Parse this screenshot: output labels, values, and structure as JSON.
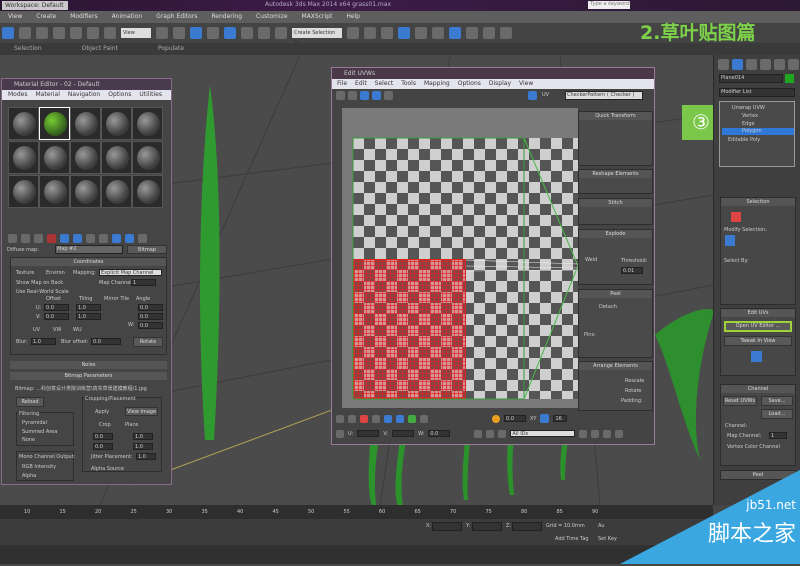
{
  "titlebar": {
    "workspace": "Workspace: Default",
    "app_title": "Autodesk 3ds Max 2014 x64    grass01.max",
    "search_placeholder": "Type a keyword"
  },
  "menu": [
    "View",
    "Create",
    "Modifiers",
    "Animation",
    "Graph Editors",
    "Rendering",
    "Customize",
    "MAXScript",
    "Help"
  ],
  "toolbar": {
    "view_select": "View",
    "selection_set": "Create Selection Se"
  },
  "ribbon": [
    "Selection",
    "Object Paint",
    "Populate"
  ],
  "overlay_heading": "2.草叶贴图篇",
  "step_badge": "③",
  "material_editor": {
    "title": "Material Editor - 02 - Default",
    "menu": [
      "Modes",
      "Material",
      "Navigation",
      "Options",
      "Utilities"
    ],
    "diffuse_label": "Diffuse map:",
    "map_name": "Map #2",
    "map_type": "Bitmap",
    "coordinates": {
      "header": "Coordinates",
      "texture": "Texture",
      "environ": "Environ",
      "mapping_label": "Mapping:",
      "mapping": "Explicit Map Channel",
      "show_map_on_back": "Show Map on Back",
      "map_channel_label": "Map Channel:",
      "map_channel": "1",
      "real_world": "Use Real-World Scale",
      "offset": "Offset",
      "tiling": "Tiling",
      "mirror_tile": "Mirror Tile",
      "angle": "Angle",
      "u": "U:",
      "v": "V:",
      "w": "W:",
      "offset_u": "0.0",
      "offset_v": "0.0",
      "tiling_u": "1.0",
      "tiling_v": "1.0",
      "angle_u": "0.0",
      "angle_v": "0.0",
      "angle_w": "0.0",
      "uv": "UV",
      "vw": "VW",
      "wu": "WU",
      "blur_label": "Blur:",
      "blur": "1.0",
      "blur_offset_label": "Blur offset:",
      "blur_offset": "0.0",
      "rotate": "Rotate"
    },
    "noise": "Noise",
    "bitmap_params": {
      "header": "Bitmap Parameters",
      "bitmap_label": "Bitmap:",
      "bitmap_path": "...科创意设计类院训练营\\真实草景建模教程\\1.jpg",
      "reload": "Reload",
      "cropping": "Cropping/Placement",
      "apply": "Apply",
      "view_image": "View Image",
      "crop": "Crop",
      "place": "Place",
      "u": "0.0",
      "v": "0.0",
      "w": "1.0",
      "h": "1.0",
      "jitter": "Jitter Placement:",
      "jitter_val": "1.0",
      "filtering": "Filtering",
      "pyramidal": "Pyramidal",
      "summed": "Summed Area",
      "none": "None",
      "mono": "Mono Channel Output:",
      "rgb_intensity": "RGB Intensity",
      "alpha": "Alpha",
      "alpha_source": "Alpha Source"
    }
  },
  "edit_uvws": {
    "title": "Edit UVWs",
    "menu": [
      "File",
      "Edit",
      "Select",
      "Tools",
      "Mapping",
      "Options",
      "Display",
      "View"
    ],
    "uv_label": "UV",
    "texture_select": "CheckerPattern  ( Checker )",
    "panels": {
      "quick_transform": "Quick Transform",
      "reshape": "Reshape Elements",
      "stitch": "Stitch",
      "explode": "Explode",
      "weld": "Weld",
      "threshold_label": "Threshold:",
      "threshold": "0.01",
      "peel": "Peel",
      "detach": "Detach",
      "pins": "Pins:",
      "arrange": "Arrange Elements",
      "rescale": "Rescale",
      "rotate": "Rotate",
      "padding": "Padding:"
    },
    "bottom": {
      "soft_val": "0.0",
      "u_label": "U:",
      "v_label": "V:",
      "w_label": "W:",
      "w_val": "0.0",
      "xy": "XY",
      "grid_val": "16",
      "ids": "All IDs"
    }
  },
  "command_panel": {
    "object_name": "Plane014",
    "object_color": "#1fa51f",
    "modifier_list": "Modifier List",
    "stack": [
      {
        "label": "Unwrap UVW"
      },
      {
        "label": "Vertex"
      },
      {
        "label": "Edge"
      },
      {
        "label": "Polygon",
        "selected": true
      },
      {
        "label": "Editable Poly"
      }
    ],
    "selection": "Selection",
    "modify_selection": "Modify Selection:",
    "select_by": "Select By:",
    "edit_uvs": "Edit UVs",
    "open_uv_editor": "Open UV Editor ...",
    "tweak_in_view": "Tweak In View",
    "channel": "Channel",
    "reset_uvws": "Reset UVWs",
    "save": "Save...",
    "load": "Load...",
    "channel_group": "Channel:",
    "map_channel": "Map Channel:",
    "map_channel_val": "1",
    "vertex_color_channel": "Vertex Color Channel",
    "peel": "Peel"
  },
  "timeline": {
    "ticks": [
      "10",
      "15",
      "20",
      "25",
      "30",
      "35",
      "40",
      "45",
      "50",
      "55",
      "60",
      "65",
      "70",
      "75",
      "80",
      "85",
      "90"
    ]
  },
  "status": {
    "x": "X:",
    "y": "Y:",
    "z": "Z:",
    "grid": "Grid = 10.0mm",
    "add_time_tag": "Add Time Tag",
    "set_key": "Set Key",
    "auto": "Au"
  },
  "watermark": {
    "site": "jb51.net",
    "name": "脚本之家"
  },
  "colors": {
    "accent_green": "#7ed24a",
    "highlight_blue": "#3a7ad0",
    "selection_red": "#d22222"
  }
}
